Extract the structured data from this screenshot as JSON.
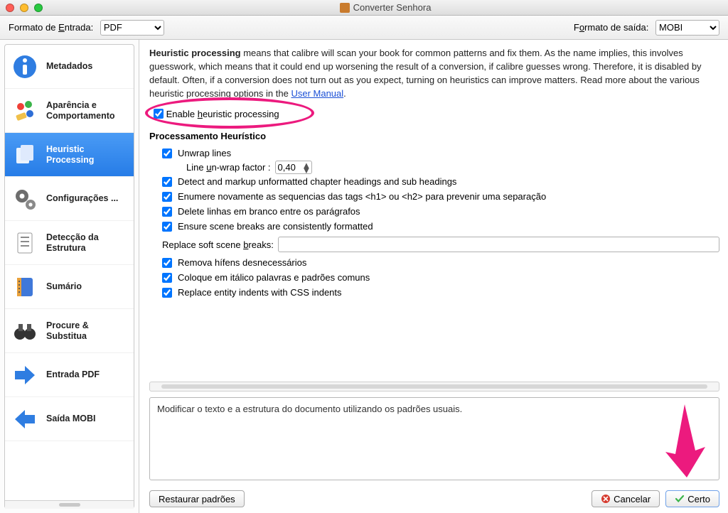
{
  "window": {
    "title": "Converter Senhora"
  },
  "format_bar": {
    "input_label_pre": "Formato de ",
    "input_label_u": "E",
    "input_label_post": "ntrada:",
    "input_value": "PDF",
    "output_label_pre": "F",
    "output_label_u": "o",
    "output_label_post": "rmato de saída:",
    "output_value": "MOBI"
  },
  "sidebar": {
    "items": [
      {
        "label": "Metadados"
      },
      {
        "label": "Aparência e Comportamento"
      },
      {
        "label": "Heuristic Processing",
        "selected": true
      },
      {
        "label": "Configurações ..."
      },
      {
        "label": "Detecção da Estrutura"
      },
      {
        "label": "Sumário"
      },
      {
        "label": "Procure & Substitua"
      },
      {
        "label": "Entrada PDF"
      },
      {
        "label": "Saída MOBI"
      }
    ]
  },
  "description": {
    "bold": "Heuristic processing",
    "text1": " means that calibre will scan your book for common patterns and fix them. As the name implies, this involves guesswork, which means that it could end up worsening the result of a conversion, if calibre guesses wrong. Therefore, it is disabled by default. Often, if a conversion does not turn out as you expect, turning on heuristics can improve matters. Read more about the various heuristic processing options in the ",
    "link": "User Manual",
    "text2": "."
  },
  "enable": {
    "label_pre": "Enable ",
    "label_u": "h",
    "label_post": "euristic processing",
    "checked": true
  },
  "section_title": "Processamento Heurístico",
  "options": {
    "unwrap": {
      "label_pre": "Unwrap lines",
      "checked": true
    },
    "unwrap_factor": {
      "label_pre": "Line ",
      "label_u": "u",
      "label_mid": "n-wrap factor :",
      "value": "0,40"
    },
    "detect": {
      "label": "Detect and markup unformatted chapter headings and sub headings",
      "checked": true
    },
    "renum": {
      "label": "Enumere novamente as sequencias das tags <h1> ou <h2> para prevenir uma separação",
      "checked": true
    },
    "delete": {
      "label": "Delete linhas em branco entre os parágrafos",
      "checked": true
    },
    "ensure": {
      "label": "Ensure scene breaks are consistently formatted",
      "checked": true
    },
    "replace_soft": {
      "label_pre": "Replace soft scene ",
      "label_u": "b",
      "label_post": "reaks:",
      "value": ""
    },
    "remove_hy": {
      "label": "Remova hífens desnecessários",
      "checked": true
    },
    "italic": {
      "label": "Coloque em itálico palavras e padrões comuns",
      "checked": true
    },
    "entity": {
      "label": "Replace entity indents with CSS indents",
      "checked": true
    }
  },
  "bottom_text": "Modificar o texto e a estrutura do documento utilizando os padrões usuais.",
  "footer": {
    "restore": "Restaurar padrões",
    "cancel": "Cancelar",
    "ok": "Certo"
  }
}
